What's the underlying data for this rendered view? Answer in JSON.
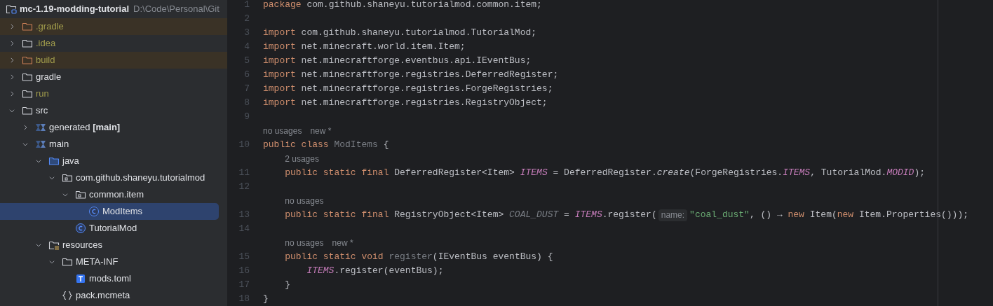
{
  "project": {
    "name": "mc-1.19-modding-tutorial",
    "path": "D:\\Code\\Personal\\Git"
  },
  "tree": [
    {
      "label": ".gradle",
      "kind": "excluded-folder",
      "color": "#a29d4c",
      "highlighted": true,
      "expanded": false,
      "selected": false
    },
    {
      "label": ".idea",
      "kind": "folder",
      "color": "#a29d4c",
      "highlighted": false,
      "expanded": false,
      "selected": false
    },
    {
      "label": "build",
      "kind": "excluded-folder",
      "color": "#a29d4c",
      "highlighted": true,
      "expanded": false,
      "selected": false
    },
    {
      "label": "gradle",
      "kind": "folder",
      "color": "#dfe1e5",
      "highlighted": false,
      "expanded": false,
      "selected": false
    },
    {
      "label": "run",
      "kind": "folder",
      "color": "#a29d4c",
      "highlighted": false,
      "expanded": false,
      "selected": false
    },
    {
      "label": "src",
      "kind": "folder",
      "color": "#dfe1e5",
      "highlighted": false,
      "expanded": true,
      "selected": false,
      "children": [
        {
          "label": "generated **[main]**",
          "kind": "module",
          "color": "#dfe1e5",
          "highlighted": false,
          "expanded": false,
          "selected": false
        },
        {
          "label": "main",
          "kind": "module",
          "color": "#dfe1e5",
          "highlighted": false,
          "expanded": true,
          "selected": false,
          "children": [
            {
              "label": "java",
              "kind": "source-folder",
              "color": "#dfe1e5",
              "highlighted": false,
              "expanded": true,
              "selected": false,
              "children": [
                {
                  "label": "com.github.shaneyu.tutorialmod",
                  "kind": "package",
                  "color": "#dfe1e5",
                  "highlighted": false,
                  "expanded": true,
                  "selected": false,
                  "children": [
                    {
                      "label": "common.item",
                      "kind": "package",
                      "color": "#dfe1e5",
                      "highlighted": false,
                      "expanded": true,
                      "selected": false,
                      "children": [
                        {
                          "label": "ModItems",
                          "kind": "class",
                          "color": "#dfe1e5",
                          "highlighted": false,
                          "selected": true
                        }
                      ]
                    },
                    {
                      "label": "TutorialMod",
                      "kind": "class",
                      "color": "#dfe1e5",
                      "highlighted": false,
                      "selected": false
                    }
                  ]
                }
              ]
            },
            {
              "label": "resources",
              "kind": "resources-folder",
              "color": "#dfe1e5",
              "highlighted": false,
              "expanded": true,
              "selected": false,
              "children": [
                {
                  "label": "META-INF",
                  "kind": "folder",
                  "color": "#dfe1e5",
                  "highlighted": false,
                  "expanded": true,
                  "selected": false,
                  "children": [
                    {
                      "label": "mods.toml",
                      "kind": "text-file",
                      "color": "#dfe1e5",
                      "highlighted": false,
                      "selected": false
                    }
                  ]
                },
                {
                  "label": "pack.mcmeta",
                  "kind": "json-file",
                  "color": "#dfe1e5",
                  "highlighted": false,
                  "selected": false
                }
              ]
            }
          ]
        }
      ]
    }
  ],
  "editor": {
    "lines": [
      {
        "kind": "code",
        "number": "1",
        "tokens": [
          {
            "kind": "keyword",
            "text": "package "
          },
          {
            "kind": "plain",
            "text": "com.github.shaneyu.tutorialmod.common.item;"
          }
        ]
      },
      {
        "kind": "code",
        "number": "2"
      },
      {
        "kind": "code",
        "number": "3",
        "tokens": [
          {
            "kind": "keyword",
            "text": "import "
          },
          {
            "kind": "plain",
            "text": "com.github.shaneyu.tutorialmod.TutorialMod;"
          }
        ]
      },
      {
        "kind": "code",
        "number": "4",
        "tokens": [
          {
            "kind": "keyword",
            "text": "import "
          },
          {
            "kind": "plain",
            "text": "net.minecraft.world.item.Item;"
          }
        ]
      },
      {
        "kind": "code",
        "number": "5",
        "tokens": [
          {
            "kind": "keyword",
            "text": "import "
          },
          {
            "kind": "plain",
            "text": "net.minecraftforge.eventbus.api.IEventBus;"
          }
        ]
      },
      {
        "kind": "code",
        "number": "6",
        "tokens": [
          {
            "kind": "keyword",
            "text": "import "
          },
          {
            "kind": "plain",
            "text": "net.minecraftforge.registries.DeferredRegister;"
          }
        ]
      },
      {
        "kind": "code",
        "number": "7",
        "tokens": [
          {
            "kind": "keyword",
            "text": "import "
          },
          {
            "kind": "plain",
            "text": "net.minecraftforge.registries.ForgeRegistries;"
          }
        ]
      },
      {
        "kind": "code",
        "number": "8",
        "tokens": [
          {
            "kind": "keyword",
            "text": "import "
          },
          {
            "kind": "plain",
            "text": "net.minecraftforge.registries.RegistryObject;"
          }
        ]
      },
      {
        "kind": "code",
        "number": "9"
      },
      {
        "kind": "inlay",
        "usages": "no usages",
        "author": "new *"
      },
      {
        "kind": "code",
        "number": "10",
        "tokens": [
          {
            "kind": "keyword",
            "text": "public class "
          },
          {
            "kind": "unused",
            "text": "ModItems "
          },
          {
            "kind": "plain",
            "text": "{"
          }
        ]
      },
      {
        "kind": "inlay",
        "usages": "2 usages"
      },
      {
        "kind": "code",
        "number": "11",
        "tokens": [
          {
            "kind": "keyword",
            "text": "    public static final "
          },
          {
            "kind": "plain",
            "text": "DeferredRegister<Item> "
          },
          {
            "kind": "static",
            "text": "ITEMS"
          },
          {
            "kind": "plain",
            "text": " = DeferredRegister."
          },
          {
            "kind": "call",
            "text": "create"
          },
          {
            "kind": "plain",
            "text": "(ForgeRegistries."
          },
          {
            "kind": "static",
            "text": "ITEMS"
          },
          {
            "kind": "plain",
            "text": ", TutorialMod."
          },
          {
            "kind": "static",
            "text": "MODID"
          },
          {
            "kind": "plain",
            "text": ");"
          }
        ]
      },
      {
        "kind": "code",
        "number": "12"
      },
      {
        "kind": "inlay",
        "usages": "no usages"
      },
      {
        "kind": "code",
        "number": "13",
        "tokens": [
          {
            "kind": "keyword",
            "text": "    public static final "
          },
          {
            "kind": "plain",
            "text": "RegistryObject<Item> "
          },
          {
            "kind": "unused-field",
            "text": "COAL_DUST"
          },
          {
            "kind": "plain",
            "text": " = "
          },
          {
            "kind": "static",
            "text": "ITEMS"
          },
          {
            "kind": "plain",
            "text": ".register("
          },
          {
            "kind": "hint",
            "text": "name:"
          },
          {
            "kind": "string",
            "text": "\"coal_dust\""
          },
          {
            "kind": "plain",
            "text": ", () → "
          },
          {
            "kind": "keyword",
            "text": "new "
          },
          {
            "kind": "plain",
            "text": "Item("
          },
          {
            "kind": "keyword",
            "text": "new "
          },
          {
            "kind": "plain",
            "text": "Item.Properties()));"
          }
        ]
      },
      {
        "kind": "code",
        "number": "14"
      },
      {
        "kind": "inlay",
        "usages": "no usages",
        "author": "new *"
      },
      {
        "kind": "code",
        "number": "15",
        "tokens": [
          {
            "kind": "keyword",
            "text": "    public static void "
          },
          {
            "kind": "unused",
            "text": "register"
          },
          {
            "kind": "plain",
            "text": "(IEventBus eventBus) {"
          }
        ]
      },
      {
        "kind": "code",
        "number": "16",
        "tokens": [
          {
            "kind": "static",
            "text": "        ITEMS"
          },
          {
            "kind": "plain",
            "text": ".register(eventBus);"
          }
        ]
      },
      {
        "kind": "code",
        "number": "17",
        "tokens": [
          {
            "kind": "plain",
            "text": "    }"
          }
        ]
      },
      {
        "kind": "code",
        "number": "18",
        "tokens": [
          {
            "kind": "plain",
            "text": "}"
          }
        ]
      }
    ]
  }
}
